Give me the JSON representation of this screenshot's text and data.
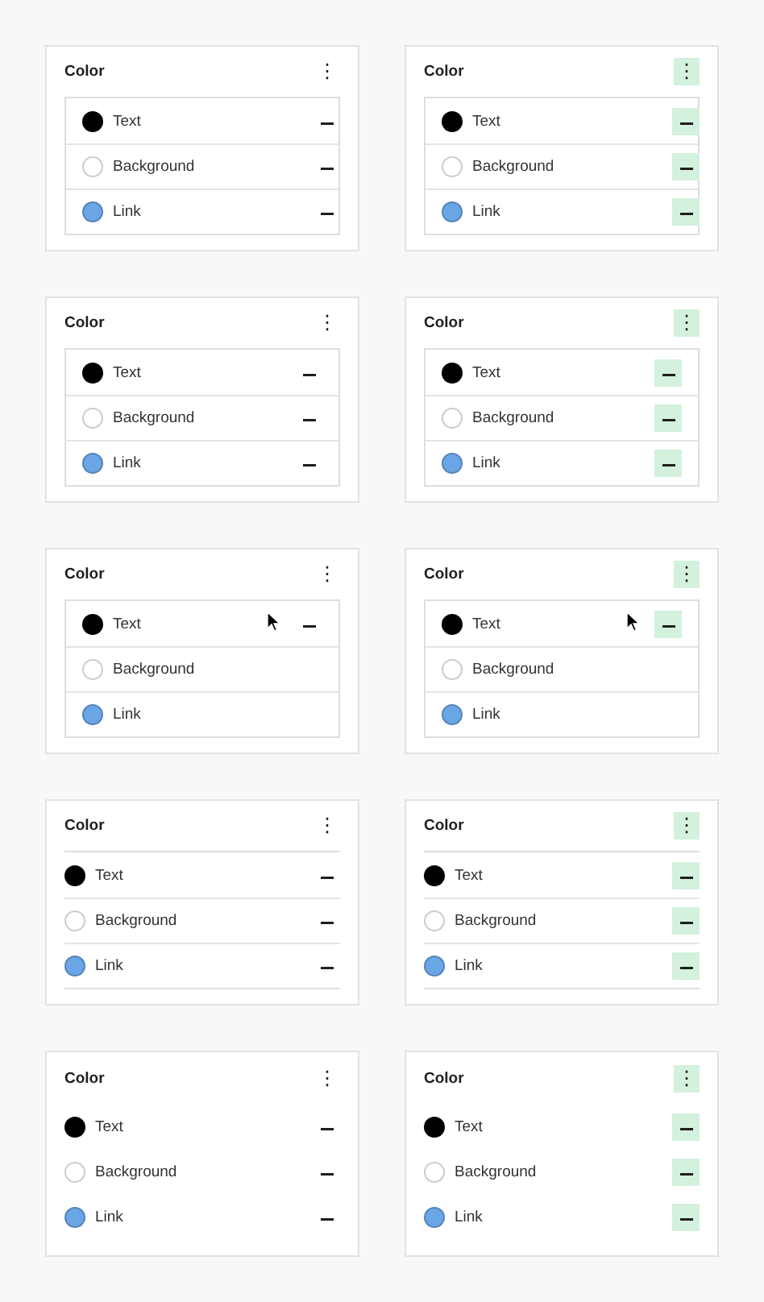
{
  "panels": [
    {
      "kind": "flush",
      "highlight_buttons": false,
      "title": "Color",
      "menu_icon": "⋮",
      "items": [
        {
          "label": "Text",
          "color": "#000000",
          "show_reset": true,
          "hovered": false
        },
        {
          "label": "Background",
          "color": "#ffffff",
          "show_reset": true,
          "hovered": false
        },
        {
          "label": "Link",
          "color": "#6aa6e6",
          "show_reset": true,
          "hovered": false
        }
      ]
    },
    {
      "kind": "flush",
      "highlight_buttons": true,
      "title": "Color",
      "menu_icon": "⋮",
      "items": [
        {
          "label": "Text",
          "color": "#000000",
          "show_reset": true,
          "hovered": false
        },
        {
          "label": "Background",
          "color": "#ffffff",
          "show_reset": true,
          "hovered": false
        },
        {
          "label": "Link",
          "color": "#6aa6e6",
          "show_reset": true,
          "hovered": false
        }
      ]
    },
    {
      "kind": "inset",
      "highlight_buttons": false,
      "title": "Color",
      "menu_icon": "⋮",
      "items": [
        {
          "label": "Text",
          "color": "#000000",
          "show_reset": true,
          "hovered": false
        },
        {
          "label": "Background",
          "color": "#ffffff",
          "show_reset": true,
          "hovered": false
        },
        {
          "label": "Link",
          "color": "#6aa6e6",
          "show_reset": true,
          "hovered": false
        }
      ]
    },
    {
      "kind": "inset",
      "highlight_buttons": true,
      "title": "Color",
      "menu_icon": "⋮",
      "items": [
        {
          "label": "Text",
          "color": "#000000",
          "show_reset": true,
          "hovered": false
        },
        {
          "label": "Background",
          "color": "#ffffff",
          "show_reset": true,
          "hovered": false
        },
        {
          "label": "Link",
          "color": "#6aa6e6",
          "show_reset": true,
          "hovered": false
        }
      ]
    },
    {
      "kind": "inset",
      "highlight_buttons": false,
      "title": "Color",
      "menu_icon": "⋮",
      "items": [
        {
          "label": "Text",
          "color": "#000000",
          "show_reset": true,
          "hovered": true
        },
        {
          "label": "Background",
          "color": "#ffffff",
          "show_reset": false,
          "hovered": false
        },
        {
          "label": "Link",
          "color": "#6aa6e6",
          "show_reset": false,
          "hovered": false
        }
      ]
    },
    {
      "kind": "inset",
      "highlight_buttons": true,
      "title": "Color",
      "menu_icon": "⋮",
      "items": [
        {
          "label": "Text",
          "color": "#000000",
          "show_reset": true,
          "hovered": true
        },
        {
          "label": "Background",
          "color": "#ffffff",
          "show_reset": false,
          "hovered": false
        },
        {
          "label": "Link",
          "color": "#6aa6e6",
          "show_reset": false,
          "hovered": false
        }
      ]
    },
    {
      "kind": "divided",
      "highlight_buttons": false,
      "title": "Color",
      "menu_icon": "⋮",
      "items": [
        {
          "label": "Text",
          "color": "#000000",
          "show_reset": true,
          "hovered": false
        },
        {
          "label": "Background",
          "color": "#ffffff",
          "show_reset": true,
          "hovered": false
        },
        {
          "label": "Link",
          "color": "#6aa6e6",
          "show_reset": true,
          "hovered": false
        }
      ]
    },
    {
      "kind": "divided",
      "highlight_buttons": true,
      "title": "Color",
      "menu_icon": "⋮",
      "items": [
        {
          "label": "Text",
          "color": "#000000",
          "show_reset": true,
          "hovered": false
        },
        {
          "label": "Background",
          "color": "#ffffff",
          "show_reset": true,
          "hovered": false
        },
        {
          "label": "Link",
          "color": "#6aa6e6",
          "show_reset": true,
          "hovered": false
        }
      ]
    },
    {
      "kind": "plain",
      "highlight_buttons": false,
      "title": "Color",
      "menu_icon": "⋮",
      "items": [
        {
          "label": "Text",
          "color": "#000000",
          "show_reset": true,
          "hovered": false
        },
        {
          "label": "Background",
          "color": "#ffffff",
          "show_reset": true,
          "hovered": false
        },
        {
          "label": "Link",
          "color": "#6aa6e6",
          "show_reset": true,
          "hovered": false
        }
      ]
    },
    {
      "kind": "plain",
      "highlight_buttons": true,
      "title": "Color",
      "menu_icon": "⋮",
      "items": [
        {
          "label": "Text",
          "color": "#000000",
          "show_reset": true,
          "hovered": false
        },
        {
          "label": "Background",
          "color": "#ffffff",
          "show_reset": true,
          "hovered": false
        },
        {
          "label": "Link",
          "color": "#6aa6e6",
          "show_reset": true,
          "hovered": false
        }
      ]
    }
  ]
}
